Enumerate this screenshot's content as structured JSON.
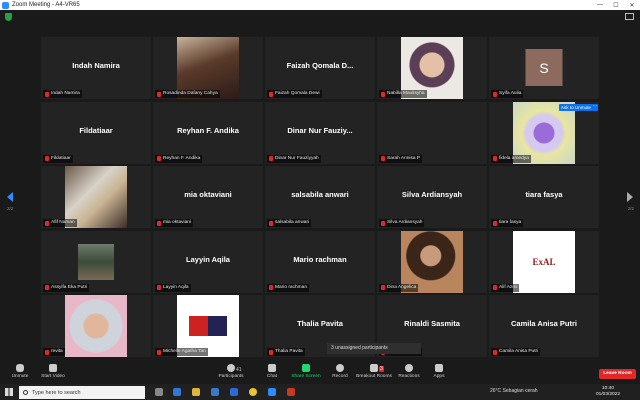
{
  "window": {
    "title": "Zoom Meeting - A4-VR65",
    "controls": [
      "—",
      "☐",
      "✕"
    ]
  },
  "tiles": [
    {
      "display": "Indah Namira",
      "label": "Indah Namira",
      "photo": ""
    },
    {
      "display": "",
      "label": "Rosadinda Dafany Cahya",
      "photo": "p-girl1"
    },
    {
      "display": "Faizah Qomala D...",
      "label": "Faizah Qomala Dewi",
      "photo": ""
    },
    {
      "display": "",
      "label": "Nabilla Maulisyha",
      "photo": "p-hijab1"
    },
    {
      "display": "",
      "label": "Syifa Aulia",
      "photo": "p-s",
      "initial": "S"
    },
    {
      "display": "Fildatiaar",
      "label": "Fildatiaar",
      "photo": ""
    },
    {
      "display": "Reyhan F. Andika",
      "label": "Reyhan F. Andika",
      "photo": ""
    },
    {
      "display": "Dinar Nur Fauziy...",
      "label": "Dinar Nur Fauziyyah",
      "photo": ""
    },
    {
      "display": "",
      "label": "Sarah Annisa P",
      "photo": ""
    },
    {
      "display": "",
      "label": "fidela amedya",
      "photo": "p-heart",
      "hover": "Ask to Unmute"
    },
    {
      "display": "",
      "label": "Afif Naman",
      "photo": "p-mirror"
    },
    {
      "display": "mia oktaviani",
      "label": "mia oktaviani",
      "photo": ""
    },
    {
      "display": "salsabila anwari",
      "label": "salsabila anwari",
      "photo": ""
    },
    {
      "display": "Silva Ardiansyah",
      "label": "Silva Ardiansyah",
      "photo": ""
    },
    {
      "display": "tiara fasya",
      "label": "tiara fasya",
      "photo": ""
    },
    {
      "display": "",
      "label": "Assyifa Eka Putri",
      "photo": "p-street"
    },
    {
      "display": "Layyin Aqila",
      "label": "Layyin Aqila",
      "photo": ""
    },
    {
      "display": "Mario rachman",
      "label": "Mario rachman",
      "photo": ""
    },
    {
      "display": "",
      "label": "Dina Angelica",
      "photo": "p-girl2"
    },
    {
      "display": "",
      "label": "Alif Azmi",
      "photo": "p-exal",
      "logo": "ExAL"
    },
    {
      "display": "",
      "label": "revita",
      "photo": "p-hijab2"
    },
    {
      "display": "",
      "label": "Michelle Agatha Tan",
      "photo": "p-univ"
    },
    {
      "display": "Thalia Pavita",
      "label": "Thalia Pavita",
      "photo": ""
    },
    {
      "display": "Rinaldi Sasmita",
      "label": "Rinaldi Sasmita",
      "photo": ""
    },
    {
      "display": "Camila Anisa Putri",
      "label": "Camila Anisa Putri",
      "photo": ""
    }
  ],
  "pagination": {
    "left": "2/2",
    "right": "2/2"
  },
  "unassigned": "3 unassigned participants",
  "toolbar": {
    "unmute": "Unmute",
    "start_video": "Start Video",
    "participants": "Participants",
    "participants_count": "41",
    "chat": "Chat",
    "share_screen": "Share Screen",
    "record": "Record",
    "breakout_rooms": "Breakout Rooms",
    "breakout_badge": "3",
    "reactions": "Reactions",
    "apps": "Apps",
    "leave": "Leave Room"
  },
  "taskbar": {
    "search_placeholder": "Type here to search",
    "weather": "26°C  Sebagian cerah",
    "time": "10:40",
    "date": "01/03/2022"
  },
  "colors": {
    "accent": "#2d8cff",
    "leave": "#e02828",
    "share": "#23d96c"
  }
}
